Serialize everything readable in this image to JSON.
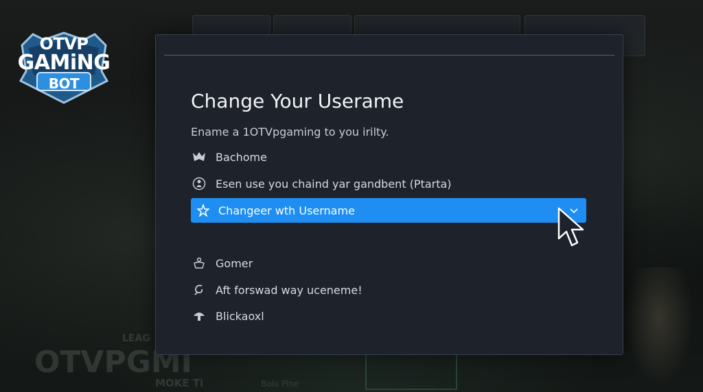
{
  "logo": {
    "line1": "OTVP",
    "line2": "GAMiNG",
    "line3": "BOT"
  },
  "background": {
    "text_league": "LEAG",
    "text_brand": "OTVPGMI",
    "text_moke": "MOKE Ti",
    "text_bolo": "Bolo Pine"
  },
  "modal": {
    "title": "Change Your Userame",
    "subtitle": "Ename a 1OTVpgaming to you irilty.",
    "options": [
      {
        "label": "Bachome",
        "icon": "mask-icon"
      },
      {
        "label": "Esen use you chaind yar gandbent (Ptarta)",
        "icon": "user-circle-icon"
      },
      {
        "label": "Changeer wth Username",
        "icon": "star-icon",
        "selected": true
      },
      {
        "label": "Gomer",
        "icon": "gamepad-icon"
      },
      {
        "label": "Aft forswad way uceneme!",
        "icon": "hook-icon"
      },
      {
        "label": "Blickaoxl",
        "icon": "mushroom-icon"
      }
    ]
  },
  "colors": {
    "accent": "#1e8ef2",
    "modal_bg": "#1d222b",
    "text": "#d7dbe0"
  }
}
